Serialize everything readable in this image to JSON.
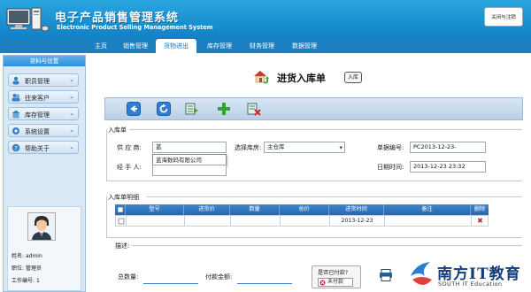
{
  "app": {
    "title_cn": "电子产品销售管理系统",
    "title_en": "Electronic Product Selling Management System",
    "logout_label": "关闭与注销"
  },
  "nav": {
    "items": [
      "主页",
      "销售管理",
      "货物进出",
      "库存管理",
      "财务管理",
      "数据管理"
    ],
    "active_index": 2
  },
  "sidebar": {
    "header": "资料与设置",
    "items": [
      {
        "label": "职员管理"
      },
      {
        "label": "往来客户"
      },
      {
        "label": "库存管理"
      },
      {
        "label": "系统设置"
      },
      {
        "label": "帮助关于"
      }
    ],
    "user": {
      "name_label": "姓名:",
      "name_value": "admin",
      "role_label": "职位:",
      "role_value": "管理员",
      "id_label": "工作编号:",
      "id_value": "1"
    }
  },
  "page": {
    "title": "进货入库单",
    "badge": "入库"
  },
  "form": {
    "section_title": "入库单",
    "supplier_label": "供 应 商:",
    "supplier_value": "蓝",
    "suggestion": "蓝海数码有限公司",
    "handler_label": "经 手 人:",
    "handler_value": "",
    "warehouse_label": "选择库房:",
    "warehouse_value": "主仓库",
    "order_no_label": "单据编号:",
    "order_no_value": "PC2013-12-23-",
    "datetime_label": "日期时间:",
    "datetime_value": "2013-12-23 23:32"
  },
  "detail": {
    "section_title": "入库单明细",
    "columns": [
      "",
      "型号",
      "进货价",
      "数量",
      "总价",
      "进货时间",
      "备注",
      "删除"
    ],
    "rows": [
      {
        "model": "",
        "price": "",
        "qty": "",
        "total": "",
        "time": "2013-12-23",
        "note": "",
        "delete": "✖"
      }
    ]
  },
  "desc": {
    "label": "描述:"
  },
  "footer": {
    "total_qty_label": "总数量:",
    "pay_amount_label": "付款金额:",
    "paid_question": "是否已付款?",
    "paid_status": "未付款"
  },
  "watermark": {
    "cn": "南方IT教育",
    "en": "SOUTH IT Education"
  },
  "colors": {
    "header_blue": "#1a8fd0",
    "table_head": "#2f76be",
    "delete_red": "#c0282d"
  }
}
